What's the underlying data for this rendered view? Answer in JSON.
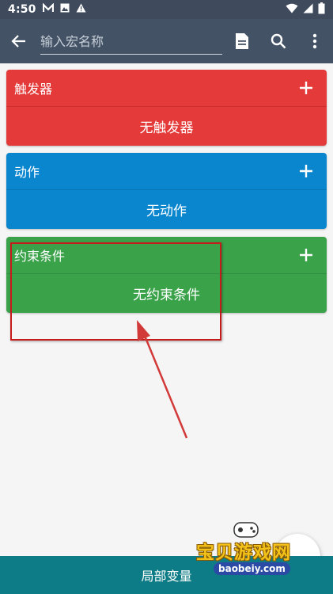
{
  "status_bar": {
    "time": "4:50",
    "icons": [
      "macrodroid-m-icon",
      "photo-icon",
      "warning-icon",
      "wifi-icon",
      "signal-icon",
      "battery-icon"
    ]
  },
  "app_bar": {
    "title_placeholder": "输入宏名称",
    "title_value": "",
    "icons": [
      "back-arrow-icon",
      "document-icon",
      "search-icon",
      "more-vert-icon"
    ]
  },
  "sections": {
    "triggers": {
      "title": "触发器",
      "empty_text": "无触发器",
      "color": "#e53a3a"
    },
    "actions": {
      "title": "动作",
      "empty_text": "无动作",
      "color": "#0a86cf"
    },
    "constraints": {
      "title": "约束条件",
      "empty_text": "无约束条件",
      "color": "#3aa34a"
    }
  },
  "bottom_bar": {
    "label": "局部变量",
    "color": "#0e7c86"
  },
  "annotation": {
    "color": "#c51b1b"
  },
  "watermark": {
    "title": "宝贝游戏网",
    "url": "baobeiy.com"
  },
  "colors": {
    "app_bar": "#435265",
    "status_bar": "#3f4b5d",
    "background": "#f5f5f5"
  }
}
